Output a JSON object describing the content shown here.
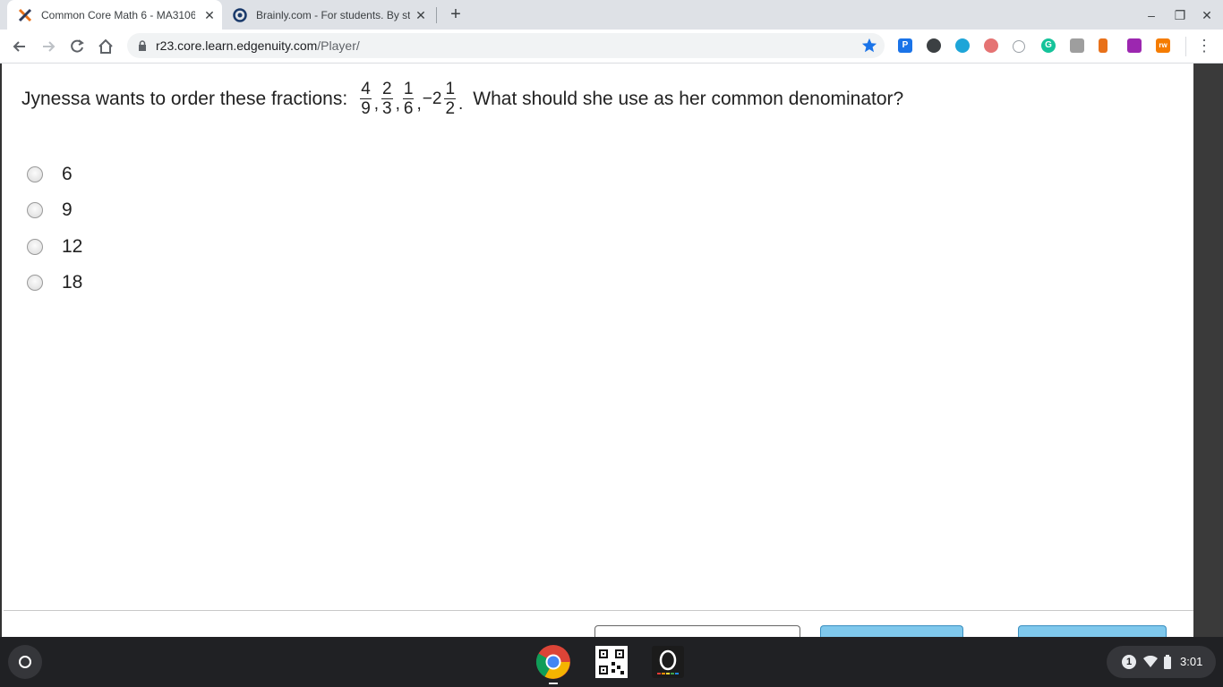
{
  "browser": {
    "tabs": [
      {
        "title": "Common Core Math 6 - MA3106",
        "favicon": "edgenuity-x-icon",
        "active": true
      },
      {
        "title": "Brainly.com - For students. By st",
        "favicon": "brainly-icon",
        "active": false
      }
    ],
    "address": {
      "host": "r23.core.learn.edgenuity.com",
      "path": "/Player/"
    },
    "extensions": [
      {
        "label": "P",
        "color": "#1a73e8"
      },
      {
        "label": "",
        "color": "#3c4043"
      },
      {
        "label": "",
        "color": "#1ea5d8"
      },
      {
        "label": "",
        "color": "#e57373"
      },
      {
        "label": "",
        "color": "#9aa0a6"
      },
      {
        "label": "G",
        "color": "#15c39a"
      },
      {
        "label": "",
        "color": "#9e9e9e"
      },
      {
        "label": "",
        "color": "#e8711a"
      },
      {
        "label": "",
        "color": "#9c27b0"
      },
      {
        "label": "rw",
        "color": "#f57c00"
      }
    ]
  },
  "question": {
    "text_before": "Jynessa wants to order these fractions:",
    "fractions": [
      {
        "num": "4",
        "den": "9"
      },
      {
        "num": "2",
        "den": "3"
      },
      {
        "num": "1",
        "den": "6"
      }
    ],
    "mixed": {
      "whole": "−2",
      "num": "1",
      "den": "2"
    },
    "text_after": "What should she use as her common denominator?"
  },
  "choices": [
    "6",
    "9",
    "12",
    "18"
  ],
  "shelf": {
    "time": "3:01",
    "notifications": "1"
  },
  "colors": {
    "accent": "#1a73e8",
    "shelf": "#202124",
    "tabstrip": "#dee1e6"
  }
}
